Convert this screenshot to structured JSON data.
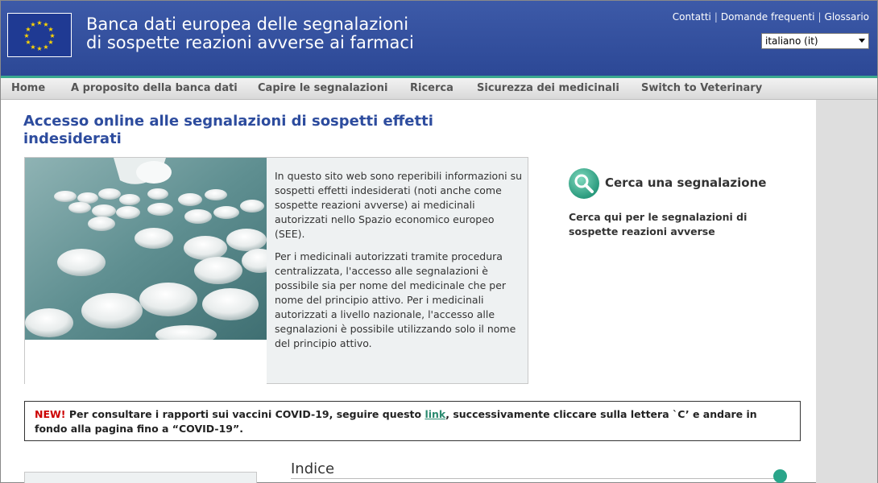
{
  "header": {
    "title_line1": "Banca dati europea delle segnalazioni",
    "title_line2": "di sospette reazioni avverse ai farmaci",
    "links": [
      "Contatti",
      "Domande frequenti",
      "Glossario"
    ],
    "language": "italiano (it)"
  },
  "nav": {
    "items": [
      "Home",
      "A proposito della banca dati",
      "Capire le segnalazioni",
      "Ricerca",
      "Sicurezza dei medicinali",
      "Switch to Veterinary"
    ]
  },
  "main": {
    "title": "Accesso online alle segnalazioni di sospetti effetti indesiderati",
    "para1": "In questo sito web sono reperibili informazioni su sospetti effetti indesiderati (noti anche come sospette reazioni avverse) ai medicinali autorizzati nello Spazio economico europeo (SEE).",
    "para2": "Per i medicinali autorizzati tramite procedura centralizzata, l'accesso alle segnalazioni è possibile sia per nome del medicinale che per nome del principio attivo. Per i medicinali autorizzati a livello nazionale, l'accesso alle segnalazioni è possibile utilizzando solo il nome del principio attivo."
  },
  "search": {
    "title": "Cerca una segnalazione",
    "description": "Cerca qui per le segnalazioni di sospette reazioni avverse"
  },
  "notice": {
    "new_label": "NEW!",
    "text_before": " Per consultare i rapporti sui vaccini COVID-19, seguire questo ",
    "link_text": "link",
    "text_after": ", successivamente cliccare sulla lettera `C’ e andare in fondo alla pagina fino a “COVID-19”."
  },
  "index": {
    "title": "Indice"
  },
  "colors": {
    "header_blue": "#2c4896",
    "accent_teal": "#39a98f",
    "title_blue": "#2d4c9e",
    "new_red": "#cc0000"
  }
}
